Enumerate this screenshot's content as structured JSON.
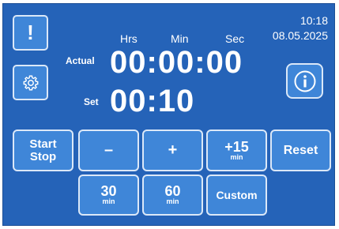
{
  "status": {
    "time": "10:18",
    "date": "08.05.2025"
  },
  "headers": {
    "hrs": "Hrs",
    "min": "Min",
    "sec": "Sec"
  },
  "timer": {
    "actual_label": "Actual",
    "actual_value": "00:00:00",
    "set_label": "Set",
    "set_value": "00:10"
  },
  "side_buttons": {
    "alert_label": "!"
  },
  "controls": {
    "start_stop_line1": "Start",
    "start_stop_line2": "Stop",
    "minus_label": "–",
    "plus_label": "+",
    "plus15_label": "+15",
    "plus15_unit": "min",
    "reset_label": "Reset",
    "preset30_label": "30",
    "preset30_unit": "min",
    "preset60_label": "60",
    "preset60_unit": "min",
    "custom_label": "Custom"
  },
  "icons": [
    "exclamation-icon",
    "gear-icon",
    "info-icon"
  ]
}
